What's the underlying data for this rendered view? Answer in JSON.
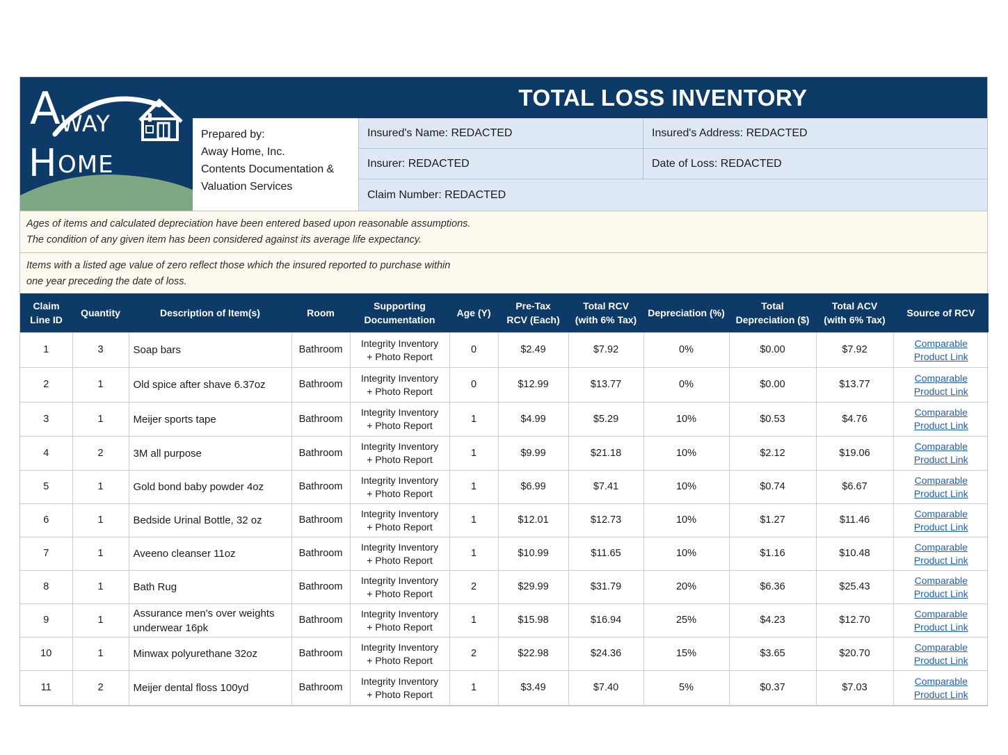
{
  "logo": {
    "line1": "WAY",
    "line2": "OME",
    "initial1": "A",
    "initial2": "H"
  },
  "header": {
    "title": "TOTAL LOSS INVENTORY",
    "prepared_by": [
      "Prepared by:",
      "Away Home, Inc.",
      "Contents Documentation &",
      "Valuation Services"
    ],
    "insured_name": "Insured's Name: REDACTED",
    "insured_address": "Insured's Address: REDACTED",
    "insurer": "Insurer: REDACTED",
    "date_of_loss": "Date of Loss: REDACTED",
    "claim_number": "Claim Number: REDACTED"
  },
  "notes": {
    "note1": [
      "Ages of items and calculated depreciation have been entered based upon reasonable assumptions.",
      "The condition of any given item has been considered against its average life expectancy."
    ],
    "note2": [
      "Items with a listed age value of zero reflect those which the insured reported to purchase within",
      "one year preceding the date of loss."
    ]
  },
  "table": {
    "headers": [
      [
        "Claim",
        "Line ID"
      ],
      [
        "Quantity"
      ],
      [
        "Description of Item(s)"
      ],
      [
        "Room"
      ],
      [
        "Supporting",
        "Documentation"
      ],
      [
        "Age (Y)"
      ],
      [
        "Pre-Tax",
        "RCV (Each)"
      ],
      [
        "Total RCV",
        "(with 6% Tax)"
      ],
      [
        "Depreciation (%)"
      ],
      [
        "Total",
        "Depreciation ($)"
      ],
      [
        "Total ACV",
        "(with 6% Tax)"
      ],
      [
        "Source of RCV"
      ]
    ],
    "doc_line1": "Integrity Inventory",
    "doc_line2": "+ Photo Report",
    "link_line1": "Comparable",
    "link_line2": "Product Link",
    "rows": [
      {
        "id": "1",
        "qty": "3",
        "desc": "Soap bars",
        "room": "Bathroom",
        "age": "0",
        "pretax": "$2.49",
        "rcv": "$7.92",
        "dep_pct": "0%",
        "dep": "$0.00",
        "acv": "$7.92"
      },
      {
        "id": "2",
        "qty": "1",
        "desc": "Old spice after shave 6.37oz",
        "room": "Bathroom",
        "age": "0",
        "pretax": "$12.99",
        "rcv": "$13.77",
        "dep_pct": "0%",
        "dep": "$0.00",
        "acv": "$13.77"
      },
      {
        "id": "3",
        "qty": "1",
        "desc": "Meijer sports tape",
        "room": "Bathroom",
        "age": "1",
        "pretax": "$4.99",
        "rcv": "$5.29",
        "dep_pct": "10%",
        "dep": "$0.53",
        "acv": "$4.76"
      },
      {
        "id": "4",
        "qty": "2",
        "desc": "3M all purpose",
        "room": "Bathroom",
        "age": "1",
        "pretax": "$9.99",
        "rcv": "$21.18",
        "dep_pct": "10%",
        "dep": "$2.12",
        "acv": "$19.06"
      },
      {
        "id": "5",
        "qty": "1",
        "desc": "Gold bond baby powder 4oz",
        "room": "Bathroom",
        "age": "1",
        "pretax": "$6.99",
        "rcv": "$7.41",
        "dep_pct": "10%",
        "dep": "$0.74",
        "acv": "$6.67"
      },
      {
        "id": "6",
        "qty": "1",
        "desc": "Bedside Urinal Bottle, 32 oz",
        "room": "Bathroom",
        "age": "1",
        "pretax": "$12.01",
        "rcv": "$12.73",
        "dep_pct": "10%",
        "dep": "$1.27",
        "acv": "$11.46"
      },
      {
        "id": "7",
        "qty": "1",
        "desc": "Aveeno cleanser 11oz",
        "room": "Bathroom",
        "age": "1",
        "pretax": "$10.99",
        "rcv": "$11.65",
        "dep_pct": "10%",
        "dep": "$1.16",
        "acv": "$10.48"
      },
      {
        "id": "8",
        "qty": "1",
        "desc": "Bath Rug",
        "room": "Bathroom",
        "age": "2",
        "pretax": "$29.99",
        "rcv": "$31.79",
        "dep_pct": "20%",
        "dep": "$6.36",
        "acv": "$25.43"
      },
      {
        "id": "9",
        "qty": "1",
        "desc": "Assurance men's over weights underwear 16pk",
        "room": "Bathroom",
        "age": "1",
        "pretax": "$15.98",
        "rcv": "$16.94",
        "dep_pct": "25%",
        "dep": "$4.23",
        "acv": "$12.70"
      },
      {
        "id": "10",
        "qty": "1",
        "desc": "Minwax polyurethane 32oz",
        "room": "Bathroom",
        "age": "2",
        "pretax": "$22.98",
        "rcv": "$24.36",
        "dep_pct": "15%",
        "dep": "$3.65",
        "acv": "$20.70"
      },
      {
        "id": "11",
        "qty": "2",
        "desc": "Meijer dental floss 100yd",
        "room": "Bathroom",
        "age": "1",
        "pretax": "$3.49",
        "rcv": "$7.40",
        "dep_pct": "5%",
        "dep": "$0.37",
        "acv": "$7.03"
      }
    ]
  },
  "colors": {
    "navy": "#0d3a66",
    "info_bg": "#dfe9f5",
    "note_bg": "#fdfaf0",
    "hill": "#7fa882",
    "link": "#1f5fb5"
  }
}
